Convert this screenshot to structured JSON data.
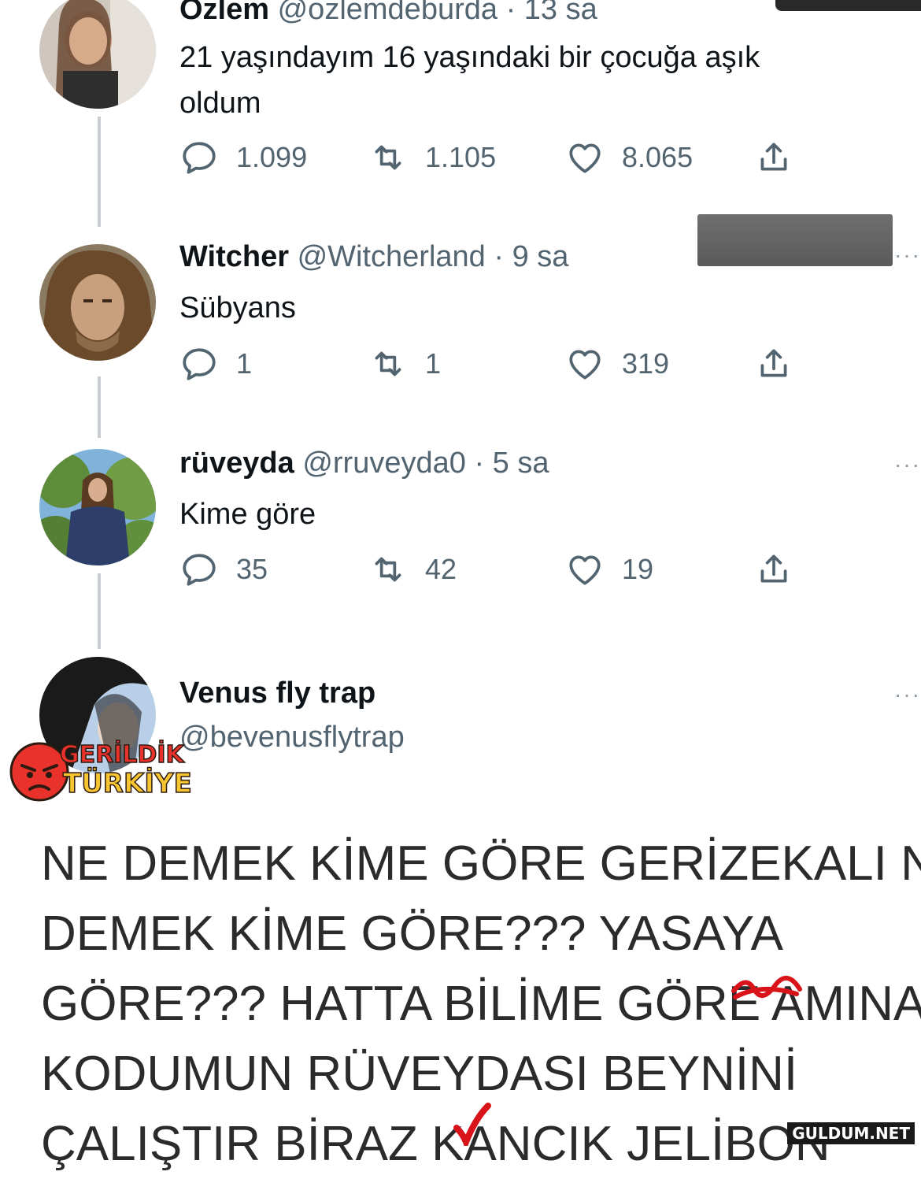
{
  "tweets": [
    {
      "name": "Özlem",
      "handle": "@ozlemdeburda",
      "time": "· 13 sa",
      "text_line1": "21 yaşındayım 16 yaşındaki bir çocuğa aşık",
      "text_line2": "oldum",
      "replies": "1.099",
      "retweets": "1.105",
      "likes": "8.065"
    },
    {
      "name": "Witcher",
      "handle": "@Witcherland",
      "time": "· 9 sa",
      "text": "Sübyans",
      "replies": "1",
      "retweets": "1",
      "likes": "319"
    },
    {
      "name": "rüveyda",
      "handle": "@rruveyda0",
      "time": "· 5 sa",
      "text": "Kime göre",
      "replies": "35",
      "retweets": "42",
      "likes": "19"
    },
    {
      "name": "Venus fly trap",
      "handle": "@bevenusflytrap"
    }
  ],
  "big_text": [
    "NE DEMEK KİME GÖRE GERİZEKALI NE",
    "DEMEK KİME GÖRE??? YASAYA",
    "GÖRE??? HATTA BİLİME GÖRE AMINA",
    "KODUMUN RÜVEYDASI BEYNİNİ",
    "ÇALIŞTIR BİRAZ KANCIK JELİBON"
  ],
  "logo": {
    "line1": "GERİLDİK",
    "line2": "TÜRKİYE"
  },
  "watermark": "GULDUM.NET",
  "more_glyph": "···",
  "colors": {
    "secondary": "#536471",
    "thread": "#c9cdd1",
    "logo_red": "#e8322b",
    "logo_yellow": "#f7c531"
  },
  "icons": [
    "reply-icon",
    "retweet-icon",
    "like-icon",
    "share-icon",
    "more-icon"
  ]
}
